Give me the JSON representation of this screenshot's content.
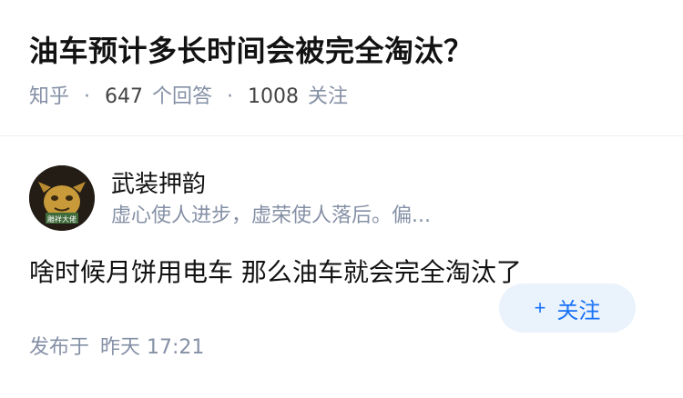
{
  "question": {
    "title": "油车预计多长时间会被完全淘汰？",
    "source": "知乎",
    "answers_count": "647",
    "answers_label": "个回答",
    "followers_count": "1008",
    "followers_label": "关注",
    "separator": "·"
  },
  "author": {
    "name": "武装押韵",
    "bio": "虚心使人进步，虚荣使人落后。偏...",
    "avatar_caption": "雕祥大佬",
    "follow_label": "关注",
    "follow_icon": "plus-icon"
  },
  "answer": {
    "content": "啥时候月饼用电车 那么油车就会完全淘汰了",
    "published_label": "发布于",
    "published_time": "昨天 17:21"
  }
}
